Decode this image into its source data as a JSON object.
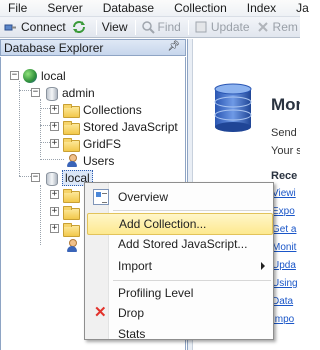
{
  "menubar": {
    "items": [
      "File",
      "Server",
      "Database",
      "Collection",
      "Index",
      "Ja"
    ]
  },
  "toolbar": {
    "connect": "Connect",
    "view": "View",
    "find": "Find",
    "update": "Update",
    "remove": "Rem"
  },
  "explorer": {
    "title": "Database Explorer",
    "server": "local",
    "admin_db": "admin",
    "collections": "Collections",
    "stored_js": "Stored JavaScript",
    "gridfs": "GridFS",
    "users": "Users",
    "local_db": "local"
  },
  "welcome": {
    "title": "Mon",
    "line1": "Send y",
    "line2": "Your s",
    "recent_heading": "Rece",
    "links": [
      "Viewi",
      "Expo",
      "Get a",
      "Monit",
      "Upda",
      "Using",
      "Data",
      "Impo"
    ]
  },
  "context_menu": {
    "overview": "Overview",
    "add_collection": "Add Collection...",
    "add_stored_js": "Add Stored JavaScript...",
    "import": "Import",
    "profiling_level": "Profiling Level",
    "drop": "Drop",
    "stats": "Stats"
  },
  "colors": {
    "accent": "#2e5db0",
    "menu_highlight": "#fde98f",
    "drop": "#e2322b",
    "link": "#1a56c8"
  }
}
